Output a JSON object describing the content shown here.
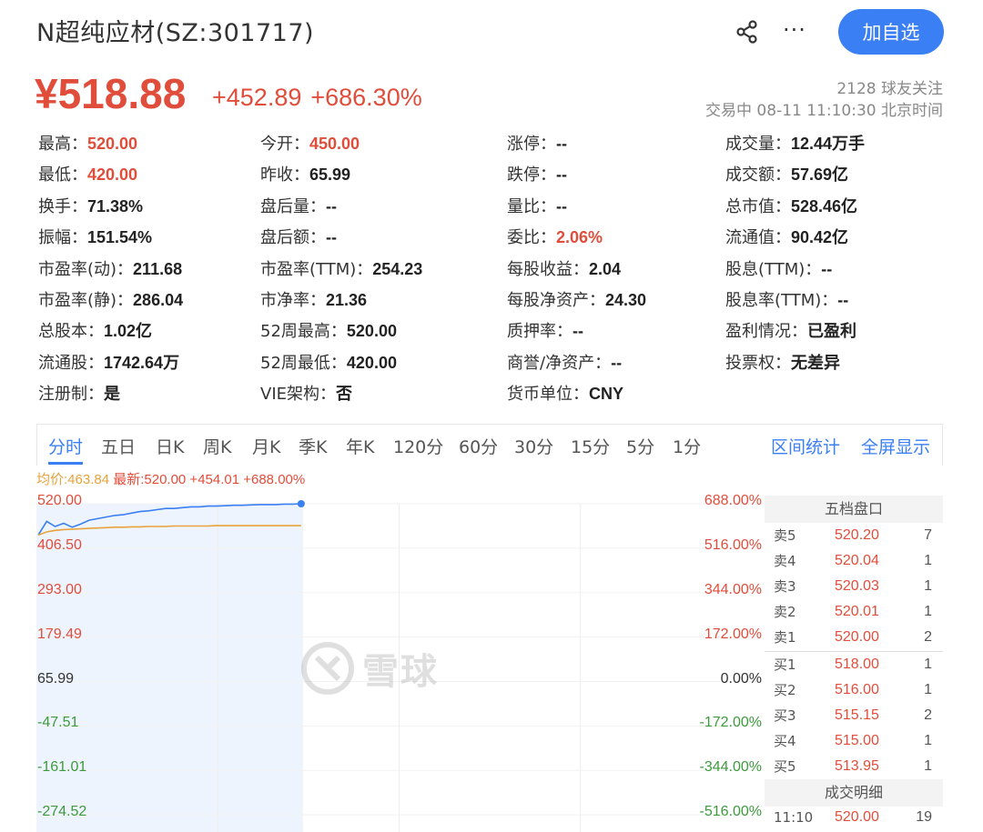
{
  "header": {
    "title": "N超纯应材(SZ:301717)",
    "follow_label": "加自选",
    "more_label": "···"
  },
  "quote": {
    "price": "¥518.88",
    "change": "+452.89",
    "change_pct": "+686.30%",
    "followers": "2128 球友关注",
    "status": "交易中 08-11 11:10:30 北京时间"
  },
  "stats": [
    {
      "label": "最高：",
      "value": "520.00",
      "highlight": true
    },
    {
      "label": "今开：",
      "value": "450.00",
      "highlight": true
    },
    {
      "label": "涨停：",
      "value": "--"
    },
    {
      "label": "成交量：",
      "value": "12.44万手"
    },
    {
      "label": "最低：",
      "value": "420.00",
      "highlight": true
    },
    {
      "label": "昨收：",
      "value": "65.99"
    },
    {
      "label": "跌停：",
      "value": "--"
    },
    {
      "label": "成交额：",
      "value": "57.69亿"
    },
    {
      "label": "换手：",
      "value": "71.38%"
    },
    {
      "label": "盘后量：",
      "value": "--"
    },
    {
      "label": "量比：",
      "value": "--"
    },
    {
      "label": "总市值：",
      "value": "528.46亿"
    },
    {
      "label": "振幅：",
      "value": "151.54%"
    },
    {
      "label": "盘后额：",
      "value": "--"
    },
    {
      "label": "委比：",
      "value": "2.06%",
      "highlight": true
    },
    {
      "label": "流通值：",
      "value": "90.42亿"
    },
    {
      "label": "市盈率(动)：",
      "value": "211.68"
    },
    {
      "label": "市盈率(TTM)：",
      "value": "254.23"
    },
    {
      "label": "每股收益：",
      "value": "2.04"
    },
    {
      "label": "股息(TTM)：",
      "value": "--"
    },
    {
      "label": "市盈率(静)：",
      "value": "286.04"
    },
    {
      "label": "市净率：",
      "value": "21.36"
    },
    {
      "label": "每股净资产：",
      "value": "24.30"
    },
    {
      "label": "股息率(TTM)：",
      "value": "--"
    },
    {
      "label": "总股本：",
      "value": "1.02亿"
    },
    {
      "label": "52周最高：",
      "value": "520.00"
    },
    {
      "label": "质押率：",
      "value": "--"
    },
    {
      "label": "盈利情况：",
      "value": "已盈利"
    },
    {
      "label": "流通股：",
      "value": "1742.64万"
    },
    {
      "label": "52周最低：",
      "value": "420.00"
    },
    {
      "label": "商誉/净资产：",
      "value": "--"
    },
    {
      "label": "投票权：",
      "value": "无差异"
    },
    {
      "label": "注册制：",
      "value": "是"
    },
    {
      "label": "VIE架构：",
      "value": "否"
    },
    {
      "label": "货币单位：",
      "value": "CNY"
    }
  ],
  "tabs": [
    "分时",
    "五日",
    "日K",
    "周K",
    "月K",
    "季K",
    "年K",
    "120分",
    "60分",
    "30分",
    "15分",
    "5分",
    "1分"
  ],
  "tab_actions": [
    "区间统计",
    "全屏显示"
  ],
  "legend": {
    "avg": "均价:463.84",
    "latest": "最新:520.00 +454.01 +688.00%"
  },
  "watermark": "雪球",
  "colors": {
    "up": "#e14d3b",
    "down": "#3d9a3d",
    "accent": "#3a7ff3",
    "avg_line": "#e9a23b"
  },
  "chart_data": {
    "type": "line",
    "y_left": [
      "520.00",
      "406.50",
      "293.00",
      "179.49",
      "65.99",
      "-47.51",
      "-161.01",
      "-274.52"
    ],
    "y_right": [
      "688.00%",
      "516.00%",
      "344.00%",
      "172.00%",
      "0.00%",
      "-172.00%",
      "-344.00%",
      "-516.00%"
    ],
    "ylim": [
      -388.02,
      520.0
    ],
    "x_progress": 0.37,
    "series": [
      {
        "color": "#3a7ff3",
        "values": [
          440,
          475,
          462,
          470,
          460,
          468,
          478,
          482,
          486,
          490,
          492,
          496,
          500,
          502,
          505,
          508,
          508,
          510,
          512,
          512,
          514,
          514,
          515,
          516,
          516,
          517,
          518,
          518,
          518,
          519,
          519,
          520
        ]
      },
      {
        "color": "#e9a23b",
        "values": [
          440,
          448,
          452,
          454,
          455,
          456,
          457,
          458,
          459,
          460,
          460,
          461,
          461,
          462,
          462,
          462,
          463,
          463,
          463,
          463,
          463,
          464,
          464,
          464,
          464,
          464,
          464,
          464,
          464,
          464,
          464,
          464
        ]
      }
    ]
  },
  "order_book": {
    "title": "五档盘口",
    "asks": [
      {
        "label": "卖5",
        "price": "520.20",
        "volume": "7"
      },
      {
        "label": "卖4",
        "price": "520.04",
        "volume": "1"
      },
      {
        "label": "卖3",
        "price": "520.03",
        "volume": "1"
      },
      {
        "label": "卖2",
        "price": "520.01",
        "volume": "1"
      },
      {
        "label": "卖1",
        "price": "520.00",
        "volume": "2"
      }
    ],
    "bids": [
      {
        "label": "买1",
        "price": "518.00",
        "volume": "1"
      },
      {
        "label": "买2",
        "price": "516.00",
        "volume": "1"
      },
      {
        "label": "买3",
        "price": "515.15",
        "volume": "2"
      },
      {
        "label": "买4",
        "price": "515.00",
        "volume": "1"
      },
      {
        "label": "买5",
        "price": "513.95",
        "volume": "1"
      }
    ],
    "trades_title": "成交明细",
    "trades": [
      {
        "time": "11:10",
        "price": "520.00",
        "volume": "19"
      }
    ]
  }
}
